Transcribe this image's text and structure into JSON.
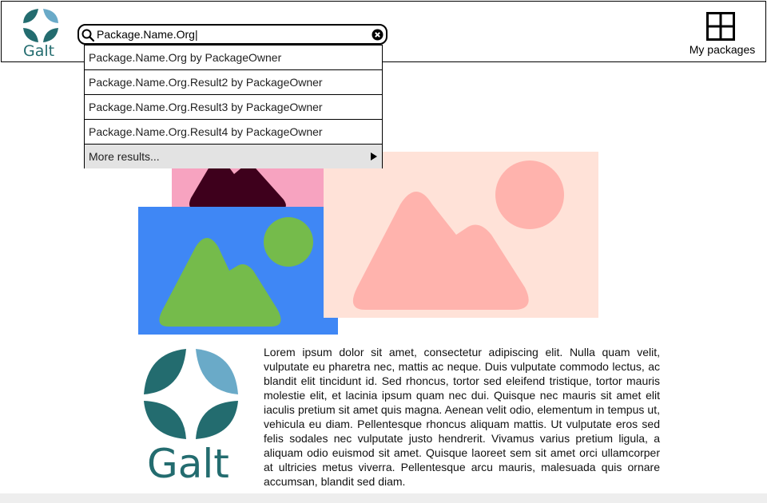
{
  "brand": {
    "name": "Galt",
    "logo_icon": "galt-logo-icon",
    "color_dark": "#236c6f",
    "color_light": "#6aaac8"
  },
  "search": {
    "value": "Package.Name.Org|",
    "icon": "search-icon",
    "clear_icon": "clear-icon"
  },
  "header": {
    "apps_label": "My packages",
    "apps_icon": "grid-icon"
  },
  "dropdown": {
    "items": [
      "Package.Name.Org by PackageOwner",
      "Package.Name.Org.Result2 by PackageOwner",
      "Package.Name.Org.Result3 by PackageOwner",
      "Package.Name.Org.Result4 by PackageOwner"
    ],
    "more_label": "More results...",
    "more_icon": "play-right-icon",
    "more_bg": "#e3e3e3"
  },
  "images": {
    "pink": {
      "bg": "#f7a3c0",
      "shape": "#3e001c"
    },
    "blue": {
      "bg": "#3f87f5",
      "shape": "#75bb4b"
    },
    "peach": {
      "bg": "#ffe2d8",
      "shape": "#ffb3ad"
    }
  },
  "content": {
    "paragraph": "Lorem ipsum dolor sit amet, consectetur adipiscing elit. Nulla quam velit, vulputate eu pharetra nec, mattis ac neque. Duis vulputate commodo lectus, ac blandit elit tincidunt id. Sed rhoncus, tortor sed eleifend tristique, tortor mauris molestie elit, et lacinia ipsum quam nec dui. Quisque nec mauris sit amet elit iaculis pretium sit amet quis magna. Aenean velit odio, elementum in tempus ut, vehicula eu diam. Pellentesque rhoncus aliquam mattis. Ut vulputate eros sed felis sodales nec vulputate justo hendrerit. Vivamus varius pretium ligula, a aliquam odio euismod sit amet. Quisque laoreet sem sit amet orci ullamcorper at ultricies metus viverra. Pellentesque arcu mauris, malesuada quis ornare accumsan, blandit sed diam."
  }
}
